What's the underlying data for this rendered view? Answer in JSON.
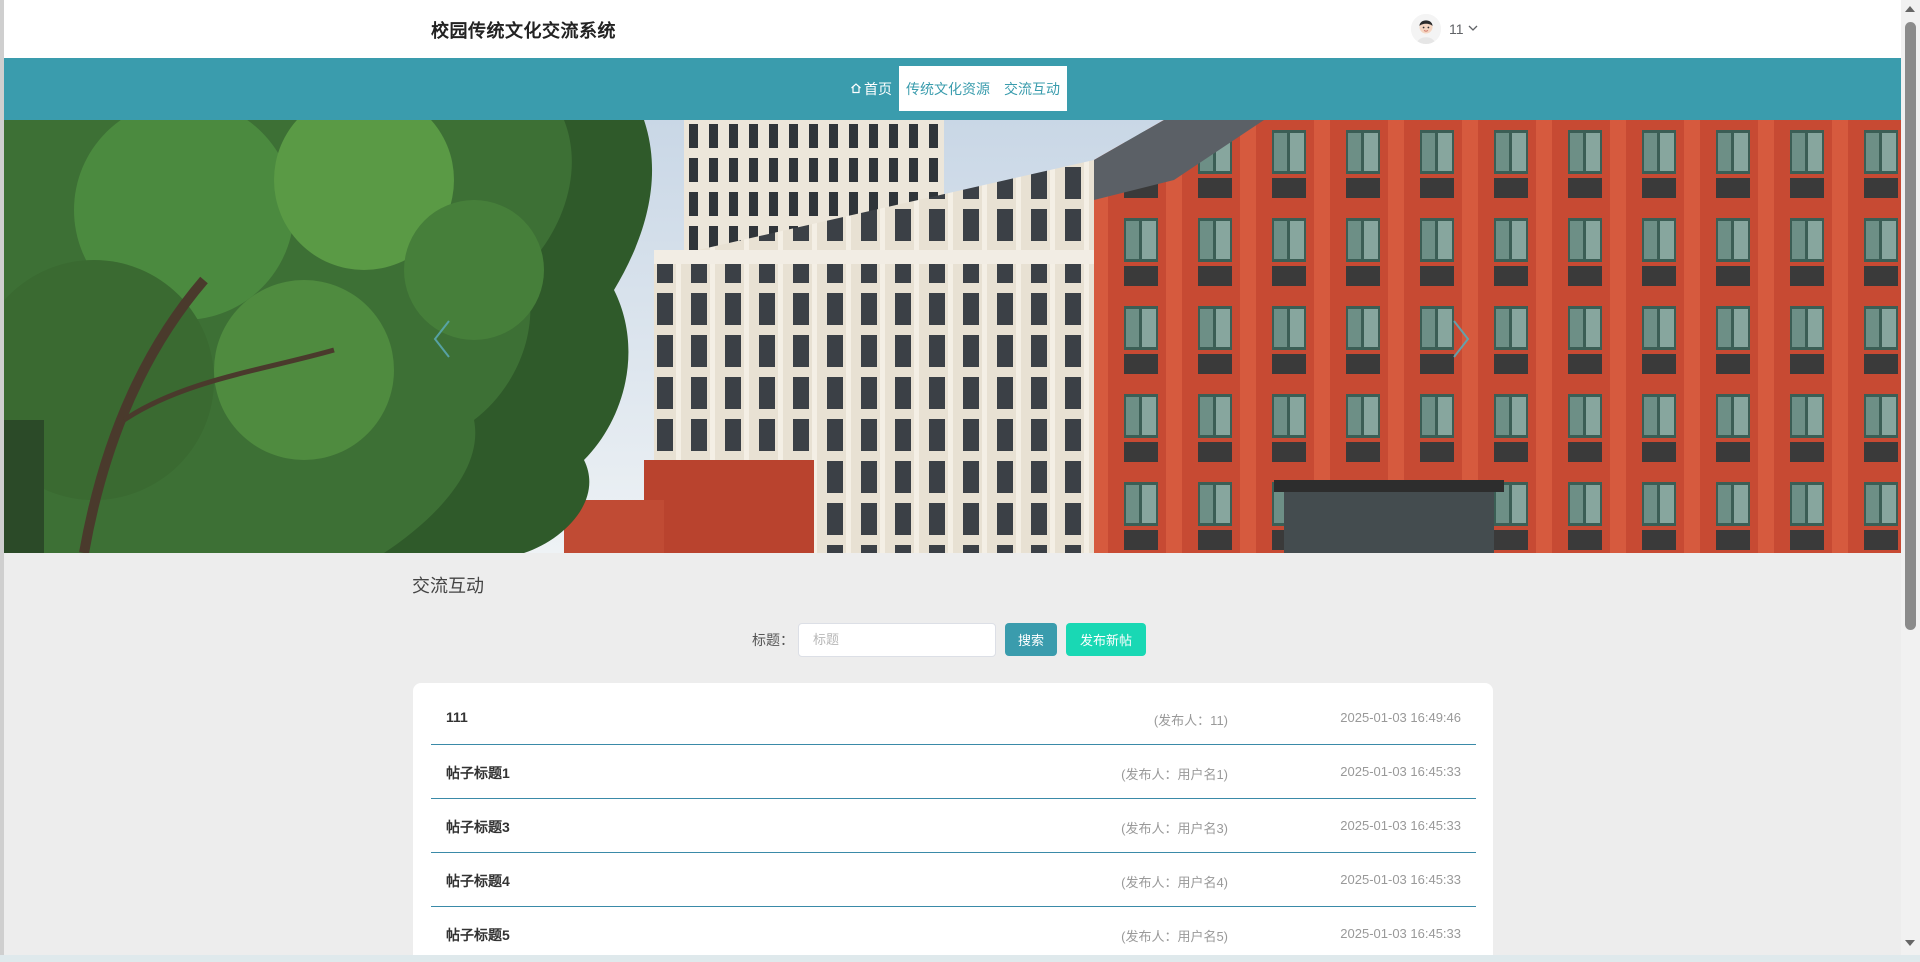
{
  "header": {
    "site_title": "校园传统文化交流系统",
    "user": {
      "name": "11",
      "avatar": "user-avatar"
    }
  },
  "nav": {
    "items": [
      {
        "label": "首页",
        "icon": "home-icon"
      },
      {
        "label": "传统文化资源"
      },
      {
        "label": "交流互动"
      }
    ]
  },
  "banner": {
    "prev_icon": "chevron-left-icon",
    "next_icon": "chevron-right-icon"
  },
  "section": {
    "title": "交流互动",
    "search": {
      "label": "标题：",
      "placeholder": "标题",
      "value": ""
    },
    "buttons": {
      "search": "搜索",
      "new_post": "发布新帖"
    }
  },
  "posts": [
    {
      "title": "111",
      "author": "(发布人：11)",
      "time": "2025-01-03 16:49:46"
    },
    {
      "title": "帖子标题1",
      "author": "(发布人：用户名1)",
      "time": "2025-01-03 16:45:33"
    },
    {
      "title": "帖子标题3",
      "author": "(发布人：用户名3)",
      "time": "2025-01-03 16:45:33"
    },
    {
      "title": "帖子标题4",
      "author": "(发布人：用户名4)",
      "time": "2025-01-03 16:45:33"
    },
    {
      "title": "帖子标题5",
      "author": "(发布人：用户名5)",
      "time": "2025-01-03 16:45:33"
    }
  ],
  "colors": {
    "primary": "#3a9cad",
    "accent": "#19d8b4",
    "background": "#ededed"
  }
}
